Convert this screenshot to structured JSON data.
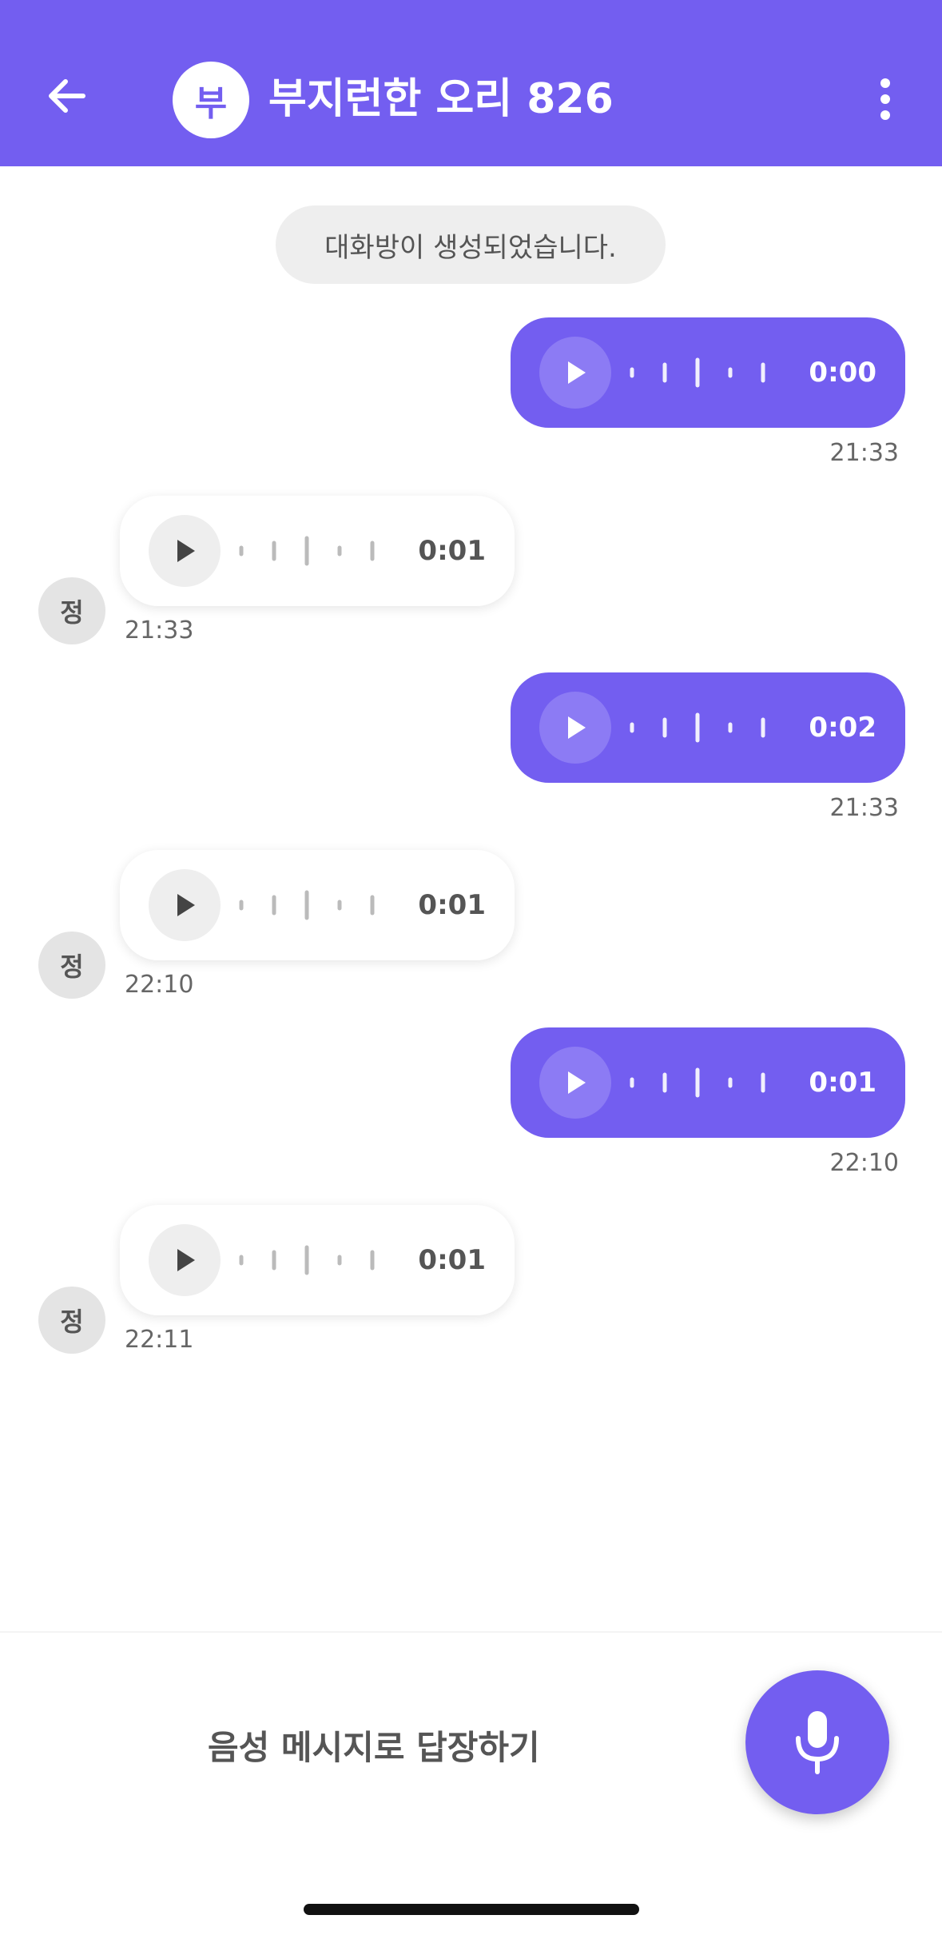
{
  "header": {
    "title": "부지런한 오리 826",
    "avatar_initial": "부",
    "back_icon": "arrow-left-icon",
    "more_icon": "more-vertical-icon"
  },
  "system_message": "대화방이 생성되었습니다.",
  "messages": [
    {
      "direction": "out",
      "duration": "0:00",
      "time": "21:33"
    },
    {
      "direction": "in",
      "duration": "0:01",
      "time": "21:33",
      "sender_initial": "정"
    },
    {
      "direction": "out",
      "duration": "0:02",
      "time": "21:33"
    },
    {
      "direction": "in",
      "duration": "0:01",
      "time": "22:10",
      "sender_initial": "정"
    },
    {
      "direction": "out",
      "duration": "0:01",
      "time": "22:10"
    },
    {
      "direction": "in",
      "duration": "0:01",
      "time": "22:11",
      "sender_initial": "정"
    }
  ],
  "footer": {
    "reply_label": "음성 메시지로 답장하기",
    "mic_icon": "microphone-icon"
  },
  "colors": {
    "accent": "#735EF0",
    "incoming_bubble": "#FFFFFF",
    "system_pill": "#EEEEEE"
  }
}
